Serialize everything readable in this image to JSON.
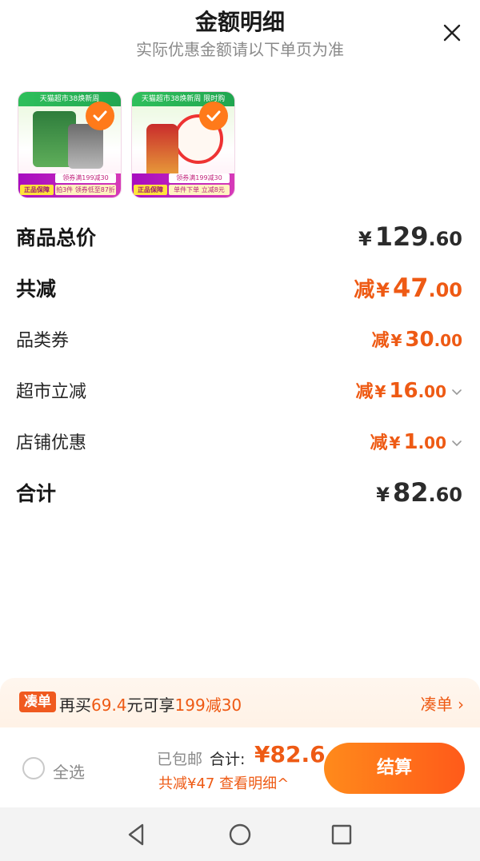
{
  "header": {
    "title": "金额明细",
    "subtitle": "实际优惠金额请以下单页为准",
    "close_icon": "close-icon"
  },
  "products": [
    {
      "topbar": "天猫超市38焕新周",
      "tag1": "领券满199减30",
      "tag2": "拍3件 领券低至87折",
      "guarantee": "正品保障",
      "selected": true
    },
    {
      "topbar": "天猫超市38焕新周 限时购",
      "tag1": "领券满199减30",
      "tag2": "单件下单 立减8元",
      "guarantee": "正品保障",
      "selected": true
    }
  ],
  "summary": {
    "goods_total": {
      "label": "商品总价",
      "yen": "¥",
      "int": "129",
      "dec": ".60"
    },
    "total_discount": {
      "label": "共减",
      "prefix": "减",
      "yen": "¥",
      "int": "47",
      "dec": ".00"
    },
    "category_coupon": {
      "label": "品类券",
      "prefix": "减",
      "yen": "¥",
      "int": "30",
      "dec": ".00"
    },
    "supermarket_discount": {
      "label": "超市立减",
      "prefix": "减",
      "yen": "¥",
      "int": "16",
      "dec": ".00"
    },
    "store_discount": {
      "label": "店铺优惠",
      "prefix": "减",
      "yen": "¥",
      "int": "1",
      "dec": ".00"
    },
    "grand_total": {
      "label": "合计",
      "yen": "¥",
      "int": "82",
      "dec": ".60"
    }
  },
  "promo": {
    "badge": "凑单",
    "text_a": "再买",
    "amount": "69.4",
    "text_b": "元可享",
    "offer": "199减30",
    "link": "凑单 ›"
  },
  "bottom_bar": {
    "select_all": "全选",
    "shipping": "已包邮",
    "total_label": "合计:",
    "total_value": "¥82.6",
    "savings": "共减¥47  查看明细^",
    "checkout": "结算"
  },
  "colors": {
    "accent": "#ee5a14",
    "checkout_gradient_start": "#ff8a1b",
    "checkout_gradient_end": "#ff5a1a"
  },
  "nav_icons": [
    "back-triangle-icon",
    "home-circle-icon",
    "recents-square-icon"
  ]
}
